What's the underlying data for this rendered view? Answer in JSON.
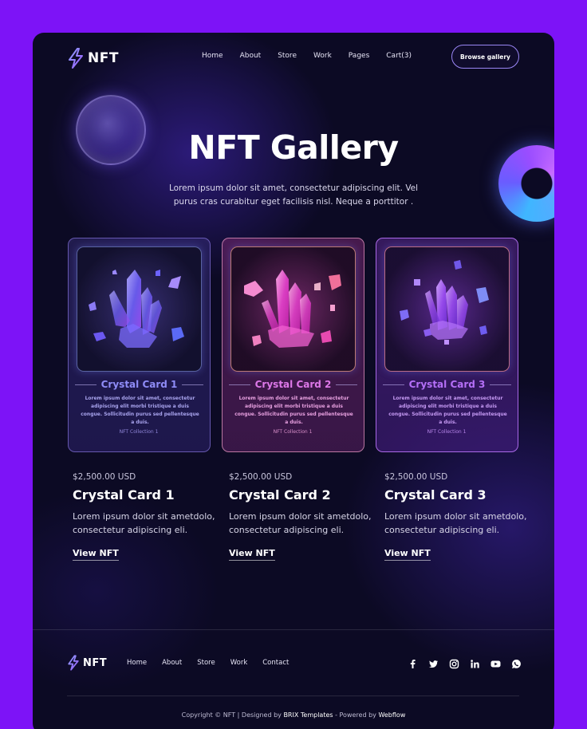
{
  "header": {
    "logo_text": "NFT",
    "nav": [
      "Home",
      "About",
      "Store",
      "Work",
      "Pages",
      "Cart(3)"
    ],
    "browse_button": "Browse gallery"
  },
  "hero": {
    "title": "NFT Gallery",
    "description": "Lorem ipsum dolor sit amet, consectetur adipiscing elit. Vel purus cras curabitur eget facilisis nisl. Neque a porttitor ."
  },
  "cards": [
    {
      "name": "Crystal Card 1",
      "description": "Lorem ipsum dolor sit amet, consectetur adipiscing elit morbi tristique a duis congue. Sollicitudin purus sed pellentesque a duis.",
      "collection": "NFT Collection 1",
      "price": "$2,500.00 USD",
      "title": "Crystal Card 1",
      "summary": "Lorem ipsum dolor sit ametdolo, consectetur adipiscing eli.",
      "link": "View NFT"
    },
    {
      "name": "Crystal Card 2",
      "description": "Lorem ipsum dolor sit amet, consectetur adipiscing elit morbi tristique a duis congue. Sollicitudin purus sed pellentesque a duis.",
      "collection": "NFT Collection 1",
      "price": "$2,500.00 USD",
      "title": "Crystal Card 2",
      "summary": "Lorem ipsum dolor sit ametdolo, consectetur adipiscing eli.",
      "link": "View NFT"
    },
    {
      "name": "Crystal Card 3",
      "description": "Lorem ipsum dolor sit amet, consectetur adipiscing elit morbi tristique a duis congue. Sollicitudin purus sed pellentesque a duis.",
      "collection": "NFT Collection 1",
      "price": "$2,500.00 USD",
      "title": "Crystal Card 3",
      "summary": "Lorem ipsum dolor sit ametdolo, consectetur adipiscing eli.",
      "link": "View NFT"
    }
  ],
  "footer": {
    "logo_text": "NFT",
    "nav": [
      "Home",
      "About",
      "Store",
      "Work",
      "Contact"
    ],
    "social_icons": [
      "facebook-icon",
      "twitter-icon",
      "instagram-icon",
      "linkedin-icon",
      "youtube-icon",
      "whatsapp-icon"
    ],
    "copyright_prefix": "Copyright © NFT | Designed by ",
    "designer": "BRIX Templates",
    "powered_prefix": " - Powered by ",
    "platform": "Webflow"
  },
  "colors": {
    "page_background": "#7d13f7",
    "frame_background": "#0c0a24",
    "card_1_accent": "#8f8cf7",
    "card_2_accent": "#dd78e8",
    "card_3_accent": "#b46ff7"
  }
}
